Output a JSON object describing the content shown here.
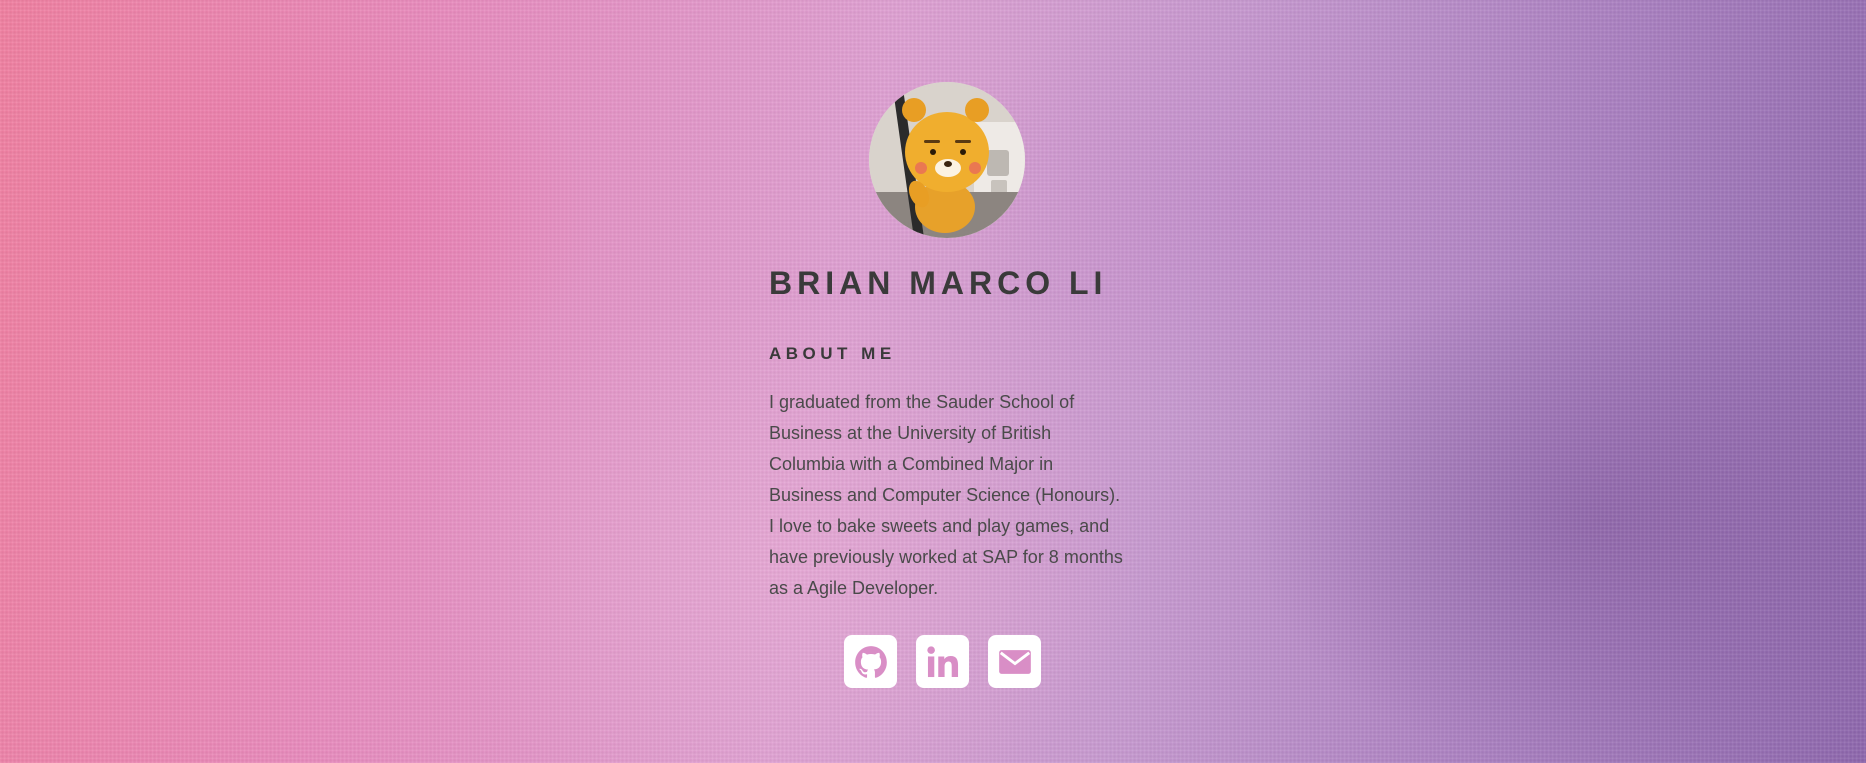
{
  "profile": {
    "name": "BRIAN MARCO LI",
    "avatar_icon": "plush-toy-avatar-photo"
  },
  "about": {
    "heading": "ABOUT ME",
    "text": "I graduated from the Sauder School of Business at the University of British Columbia with a Combined Major in Business and Computer Science (Honours). I love to bake sweets and play games, and have previously worked at SAP for 8 months as a Agile Developer."
  },
  "social_links": [
    {
      "icon": "github-icon"
    },
    {
      "icon": "linkedin-icon"
    },
    {
      "icon": "email-icon"
    }
  ],
  "colors": {
    "text_dark": "#3a3a3a",
    "body_text": "#4a4a4a",
    "icon_background": "#ffffff",
    "icon_glyph": "#d98ec6"
  }
}
